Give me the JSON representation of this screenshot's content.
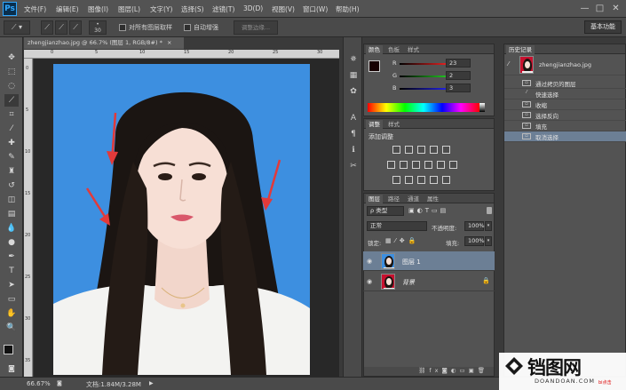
{
  "app": {
    "logo": "Ps"
  },
  "menu": [
    "文件(F)",
    "编辑(E)",
    "图像(I)",
    "图层(L)",
    "文字(Y)",
    "选择(S)",
    "滤镜(T)",
    "3D(D)",
    "视图(V)",
    "窗口(W)",
    "帮助(H)"
  ],
  "window_controls": [
    "—",
    "□",
    "✕"
  ],
  "options": {
    "sample_all_layers": "对所有图层取样",
    "auto_enhance": "自动增强",
    "refine_edge": "调整边缘...",
    "workspace": "基本功能",
    "brush_size": "30"
  },
  "document": {
    "tab_title": "zhengjianzhao.jpg @ 66.7% (图层 1, RGB/8#) *",
    "close": "×"
  },
  "rulers": {
    "top": [
      "0",
      "5",
      "10",
      "15",
      "20",
      "25",
      "30"
    ],
    "left": [
      "0",
      "5",
      "10",
      "15",
      "20",
      "25",
      "30",
      "35"
    ]
  },
  "status": {
    "zoom": "66.67%",
    "doc": "文档:1.84M/3.28M",
    "arrow": "▶"
  },
  "color_panel": {
    "tabs": [
      "颜色",
      "色板",
      "样式"
    ],
    "channels": [
      {
        "label": "R",
        "value": "23",
        "color": "#e02020"
      },
      {
        "label": "G",
        "value": "2",
        "color": "#20c020"
      },
      {
        "label": "B",
        "value": "3",
        "color": "#2020e0"
      }
    ]
  },
  "adjust_panel": {
    "tabs": [
      "调整",
      "样式"
    ],
    "title": "添加调整"
  },
  "layers_panel": {
    "tabs": [
      "图层",
      "路径",
      "通道",
      "属性"
    ],
    "filter_kind": "ρ 类型",
    "blend_mode": "正常",
    "opacity_label": "不透明度:",
    "opacity_value": "100%",
    "lock_label": "锁定:",
    "fill_label": "填充:",
    "fill_value": "100%",
    "layers": [
      {
        "name": "图层 1",
        "selected": true
      },
      {
        "name": "背景",
        "selected": false
      }
    ]
  },
  "history_panel": {
    "title": "历史记录",
    "snapshot": "zhengjianzhao.jpg",
    "items": [
      "通过拷贝的图层",
      "快速选择",
      "收缩",
      "选择反向",
      "填充",
      "取消选择"
    ],
    "selected_index": 5
  },
  "watermark": {
    "brand": "铛图网",
    "url": "DOANDOAN.COM",
    "extra": "bi点击"
  },
  "colors": {
    "photo_bg": "#3d8fe0",
    "panel": "#535353",
    "accent": "#31a8ff"
  }
}
